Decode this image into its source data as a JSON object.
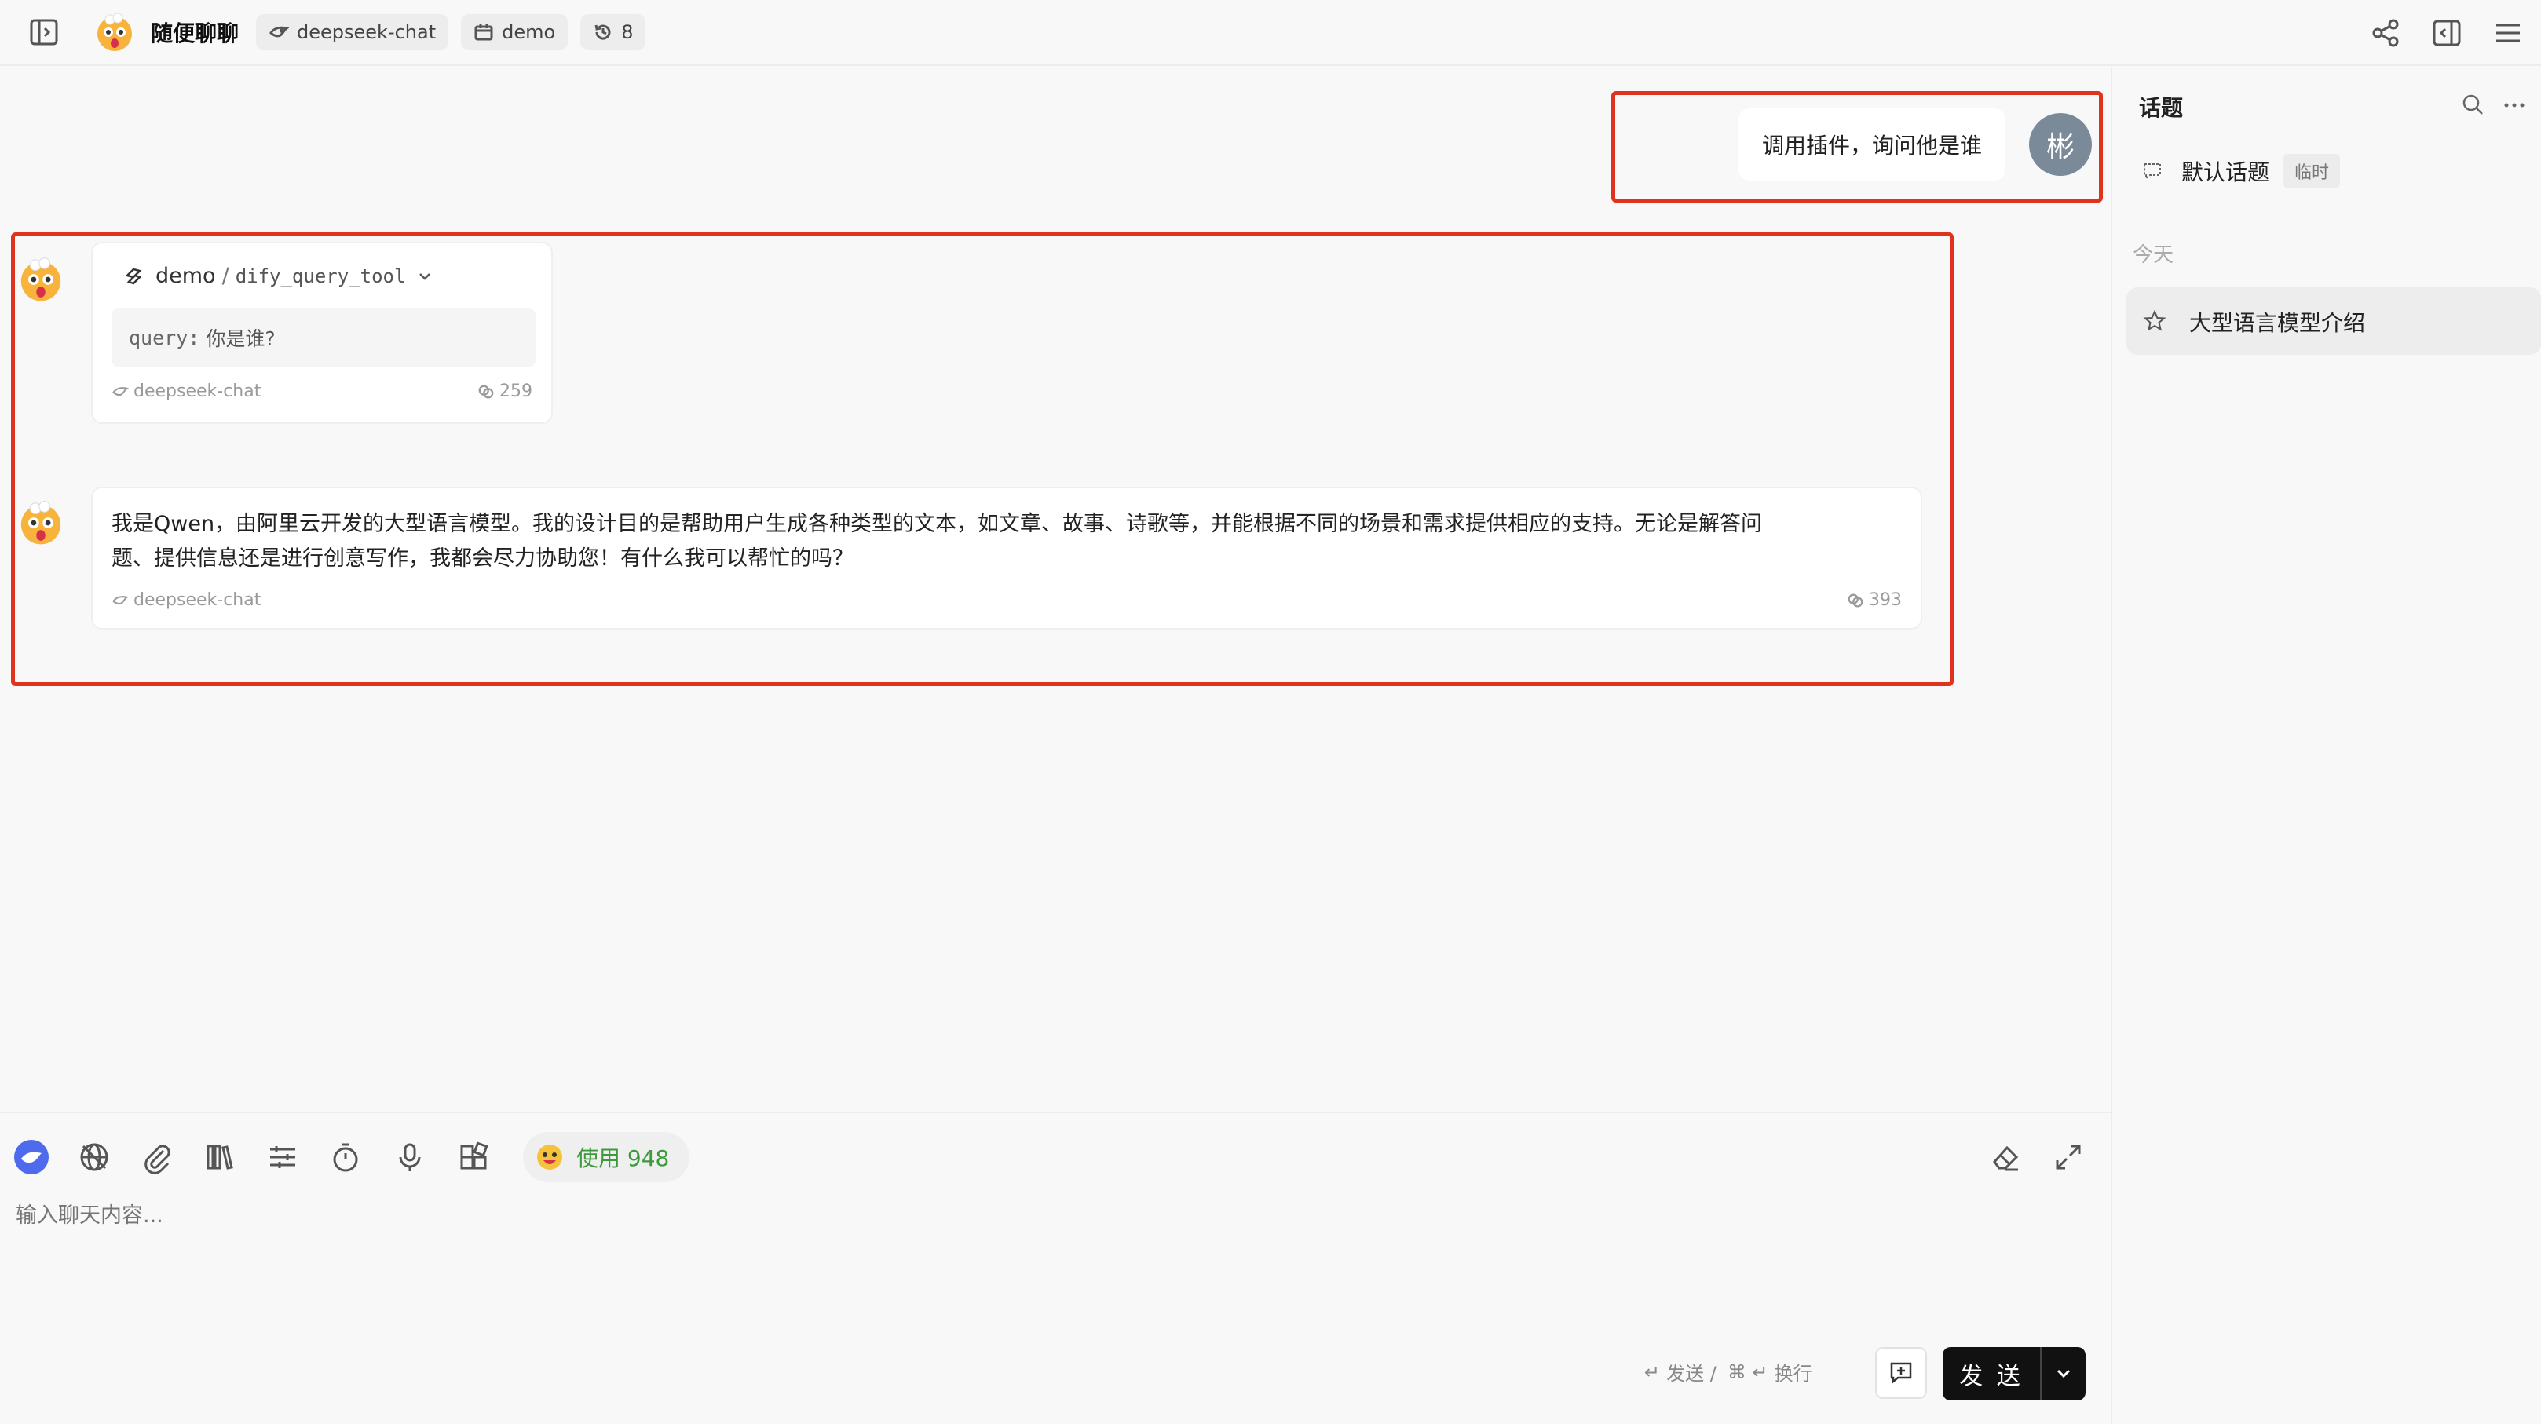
{
  "header": {
    "title": "随便聊聊",
    "model_chip": "deepseek-chat",
    "plugin_chip": "demo",
    "history_chip": "8"
  },
  "messages": {
    "user": {
      "text": "调用插件，询问他是谁",
      "avatar_char": "彬"
    },
    "tool_call": {
      "plugin": "demo",
      "separator": "/",
      "tool": "dify_query_tool",
      "arg_key": "query:",
      "arg_value": "你是谁?",
      "model": "deepseek-chat",
      "tokens": "259"
    },
    "assistant": {
      "text": "我是Qwen，由阿里云开发的大型语言模型。我的设计目的是帮助用户生成各种类型的文本，如文章、故事、诗歌等，并能根据不同的场景和需求提供相应的支持。无论是解答问题、提供信息还是进行创意写作，我都会尽力协助您！有什么我可以帮忙的吗？",
      "line1": "我是Qwen，由阿里云开发的大型语言模型。我的设计目的是帮助用户生成各种类型的文本，如文章、故事、诗歌等，并能根据不同的场景和需求提供相应的支持。无论是解答问",
      "line2": "题、提供信息还是进行创意写作，我都会尽力协助您！有什么我可以帮忙的吗？",
      "model": "deepseek-chat",
      "tokens": "393"
    }
  },
  "panel": {
    "title": "话题",
    "default_topic": "默认话题",
    "default_badge": "临时",
    "group_today": "今天",
    "topic_1": "大型语言模型介绍"
  },
  "input": {
    "usage_label": "使用 948",
    "placeholder": "输入聊天内容...",
    "hint_send": "发送 /",
    "hint_newline": "换行",
    "send_label": "发 送"
  },
  "colors": {
    "accent_red": "#e0331e",
    "send_bg": "#111111",
    "usage_green": "#3b9a3b",
    "user_avatar": "#7b8a99"
  },
  "icons": [
    "sidebar-toggle-icon",
    "share-icon",
    "panel-right-icon",
    "menu-icon",
    "search-icon",
    "more-icon",
    "chat-bubble-icon",
    "star-icon",
    "model-icon",
    "eraser-icon",
    "expand-icon"
  ]
}
